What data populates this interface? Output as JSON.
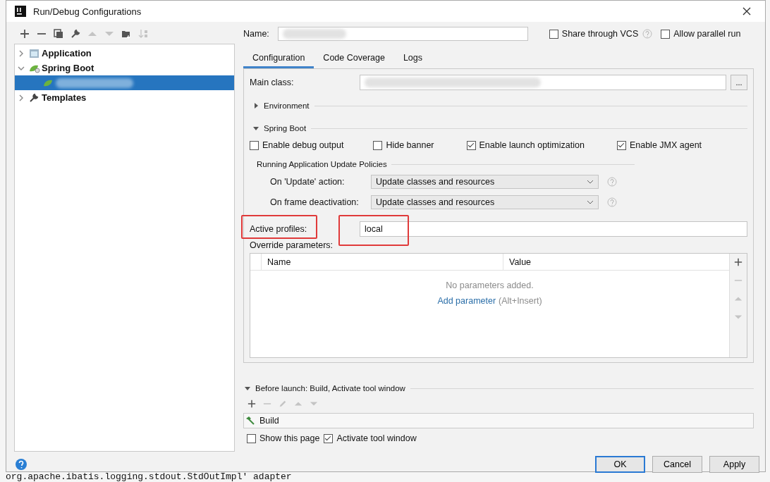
{
  "window": {
    "title": "Run/Debug Configurations"
  },
  "left_toolbar": [
    {
      "kind": "add",
      "disabled": false
    },
    {
      "kind": "remove",
      "disabled": false
    },
    {
      "kind": "copy",
      "disabled": false
    },
    {
      "kind": "wrench",
      "disabled": false
    },
    {
      "kind": "up",
      "disabled": true
    },
    {
      "kind": "down",
      "disabled": true
    },
    {
      "kind": "folder",
      "disabled": false
    },
    {
      "kind": "sort",
      "disabled": true
    }
  ],
  "tree": [
    {
      "label": "Application",
      "kind": "application",
      "expanded": false,
      "selected": false
    },
    {
      "label": "Spring Boot",
      "kind": "spring",
      "expanded": true,
      "selected": false,
      "children": [
        {
          "kind": "spring",
          "selected": true
        }
      ]
    },
    {
      "label": "Templates",
      "kind": "wrench",
      "expanded": false,
      "selected": false
    }
  ],
  "name": {
    "label": "Name:"
  },
  "options": [
    {
      "label": "Share through VCS",
      "checked": false,
      "help": true
    },
    {
      "label": "Allow parallel run",
      "checked": false,
      "help": false
    }
  ],
  "tabs": [
    {
      "label": "Configuration",
      "selected": true
    },
    {
      "label": "Code Coverage",
      "selected": false
    },
    {
      "label": "Logs",
      "selected": false
    }
  ],
  "main_class": {
    "label": "Main class:",
    "button": "..."
  },
  "sections": [
    {
      "label": "Environment",
      "expanded": false
    },
    {
      "label": "Spring Boot",
      "expanded": true
    }
  ],
  "spring_checks": [
    {
      "label": "Enable debug output",
      "checked": false
    },
    {
      "label": "Hide banner",
      "checked": false
    },
    {
      "label": "Enable launch optimization",
      "checked": true
    },
    {
      "label": "Enable JMX agent",
      "checked": true
    }
  ],
  "policies": {
    "title": "Running Application Update Policies",
    "rows": [
      {
        "label": "On 'Update' action:",
        "value": "Update classes and resources"
      },
      {
        "label": "On frame deactivation:",
        "value": "Update classes and resources"
      }
    ]
  },
  "active_profiles": {
    "label": "Active profiles:",
    "value": "local",
    "highlighted": true
  },
  "override": {
    "label": "Override parameters:",
    "columns": [
      "Name",
      "Value"
    ],
    "empty": "No parameters added.",
    "link": "Add parameter",
    "shortcut": "(Alt+Insert)",
    "tools": [
      {
        "kind": "add",
        "disabled": false
      },
      {
        "kind": "remove",
        "disabled": true
      },
      {
        "kind": "up",
        "disabled": true
      },
      {
        "kind": "down",
        "disabled": true
      }
    ]
  },
  "before_launch": {
    "label": "Before launch: Build, Activate tool window",
    "expanded": true,
    "tools": [
      {
        "kind": "add",
        "disabled": false
      },
      {
        "kind": "remove",
        "disabled": true
      },
      {
        "kind": "edit",
        "disabled": true
      },
      {
        "kind": "up",
        "disabled": true
      },
      {
        "kind": "down",
        "disabled": true
      }
    ],
    "tasks": [
      {
        "label": "Build"
      }
    ]
  },
  "bottom_checks": [
    {
      "label": "Show this page",
      "checked": false
    },
    {
      "label": "Activate tool window",
      "checked": true
    }
  ],
  "buttons": [
    {
      "label": "OK",
      "default": true
    },
    {
      "label": "Cancel",
      "default": false
    },
    {
      "label": "Apply",
      "default": false
    }
  ],
  "editor_line": "org.apache.ibatis.logging.stdout.StdOutImpl' adapter"
}
